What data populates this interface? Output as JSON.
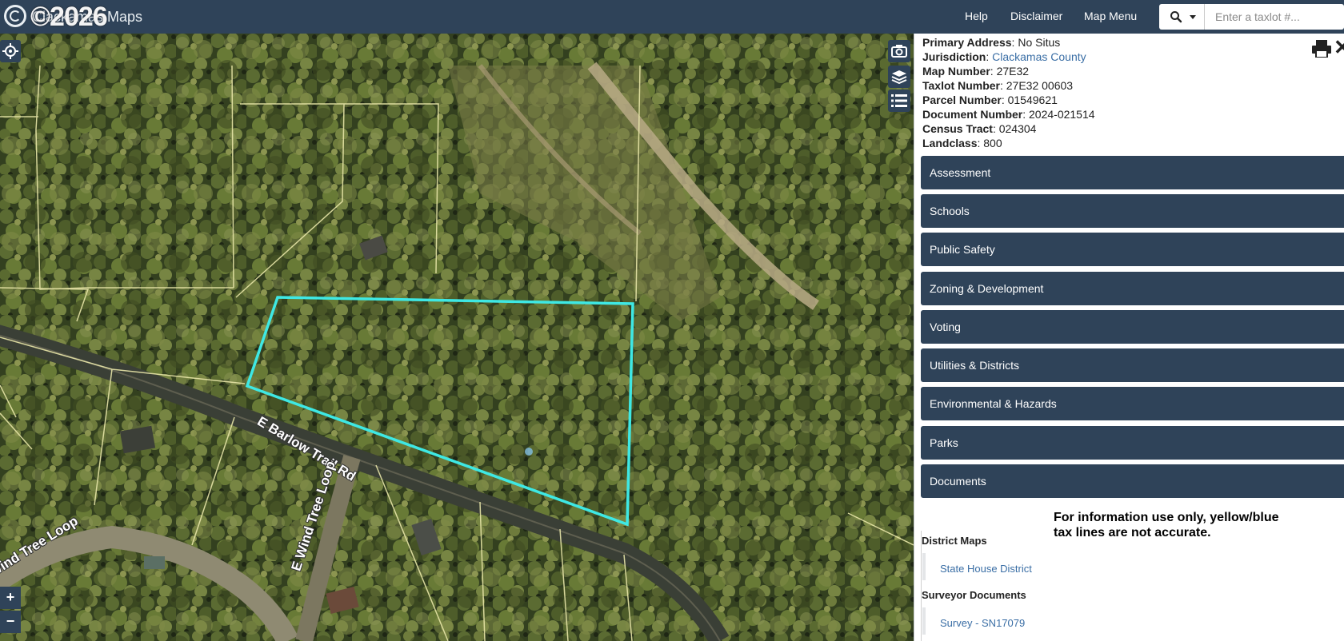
{
  "header": {
    "watermark": "©2026",
    "app_title": "Clackamas Maps",
    "nav": [
      "Help",
      "Disclaimer",
      "Map Menu"
    ],
    "search_placeholder": "Enter a taxlot #..."
  },
  "map": {
    "road_labels": [
      "E Barlow Trail Rd",
      "E Wind Tree Loop",
      "Wind Tree Loop"
    ],
    "zoom_in": "+",
    "zoom_out": "−",
    "colors": {
      "parcel_outline": "#3ee8e4",
      "taxlot_lines": "#e8e6a8"
    }
  },
  "panel": {
    "properties": [
      {
        "key": "Primary Address",
        "value": "No Situs"
      },
      {
        "key": "Jurisdiction",
        "value": "Clackamas County",
        "link": true
      },
      {
        "key": "Map Number",
        "value": "27E32"
      },
      {
        "key": "Taxlot Number",
        "value": "27E32 00603"
      },
      {
        "key": "Parcel Number",
        "value": "01549621"
      },
      {
        "key": "Document Number",
        "value": "2024-021514"
      },
      {
        "key": "Census Tract",
        "value": "024304"
      },
      {
        "key": "Landclass",
        "value": "800"
      }
    ],
    "sections": [
      "Assessment",
      "Schools",
      "Public Safety",
      "Zoning & Development",
      "Voting",
      "Utilities & Districts",
      "Environmental & Hazards",
      "Parks",
      "Documents"
    ],
    "documents": {
      "district_title": "District Maps",
      "district_link": "State House District",
      "surveyor_title": "Surveyor Documents",
      "surveyor_link": "Survey - SN17079"
    },
    "disclaimer_lines": [
      "For information use only, yellow/blue",
      "tax lines are not accurate."
    ],
    "colors": {
      "header_bg": "#2f4359",
      "link": "#3a6ea5"
    }
  }
}
